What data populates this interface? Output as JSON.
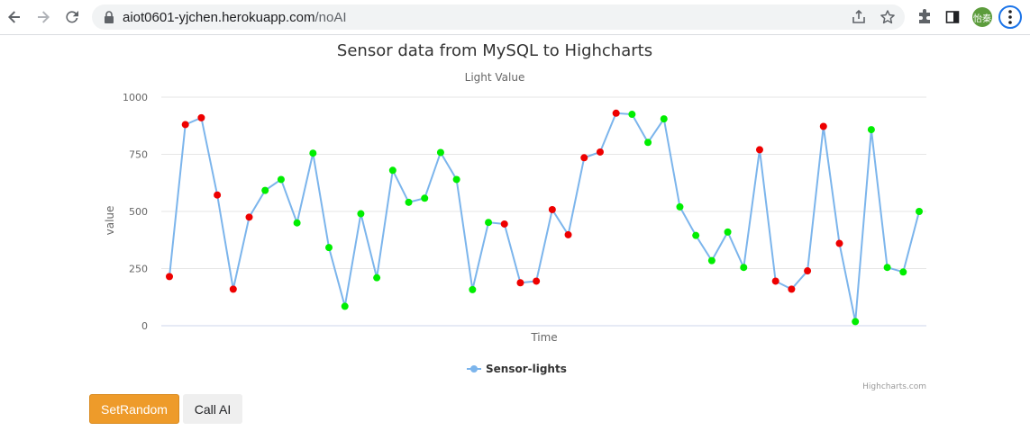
{
  "browser": {
    "url_host": "aiot0601-yjchen.herokuapp.com",
    "url_path": "/noAI",
    "avatar_text": "怡秦",
    "icons": [
      "back-arrow-icon",
      "forward-arrow-icon",
      "reload-icon",
      "lock-icon",
      "share-icon",
      "star-icon",
      "extensions-puzzle-icon",
      "side-panel-icon",
      "kebab-menu-icon"
    ]
  },
  "chart": {
    "title": "Sensor data from MySQL to Highcharts",
    "subtitle": "Light Value",
    "credits": "Highcharts.com"
  },
  "chart_data": {
    "type": "line",
    "title": "Sensor data from MySQL to Highcharts",
    "subtitle": "Light Value",
    "xlabel": "Time",
    "ylabel": "value",
    "ylim": [
      0,
      1000
    ],
    "yticks": [
      "0",
      "250",
      "500",
      "750",
      "1000"
    ],
    "grid": true,
    "legend": "bottom-center",
    "line_color": "#7cb5ec",
    "point_colors": {
      "red": "#ee0000",
      "green": "#00ee00"
    },
    "series": [
      {
        "name": "Sensor-lights",
        "values": [
          215,
          880,
          910,
          572,
          160,
          475,
          592,
          640,
          450,
          755,
          342,
          85,
          490,
          210,
          680,
          540,
          558,
          758,
          640,
          158,
          452,
          445,
          188,
          195,
          508,
          398,
          735,
          760,
          930,
          925,
          802,
          905,
          520,
          395,
          285,
          410,
          255,
          770,
          195,
          160,
          240,
          872,
          360,
          18,
          858,
          255,
          235,
          500
        ],
        "point_color": [
          "red",
          "red",
          "red",
          "red",
          "red",
          "red",
          "green",
          "green",
          "green",
          "green",
          "green",
          "green",
          "green",
          "green",
          "green",
          "green",
          "green",
          "green",
          "green",
          "green",
          "green",
          "red",
          "red",
          "red",
          "red",
          "red",
          "red",
          "red",
          "red",
          "green",
          "green",
          "green",
          "green",
          "green",
          "green",
          "green",
          "green",
          "red",
          "red",
          "red",
          "red",
          "red",
          "red",
          "green",
          "green",
          "green",
          "green",
          "green"
        ]
      }
    ]
  },
  "buttons": {
    "set_random": "SetRandom",
    "call_ai": "Call AI"
  }
}
